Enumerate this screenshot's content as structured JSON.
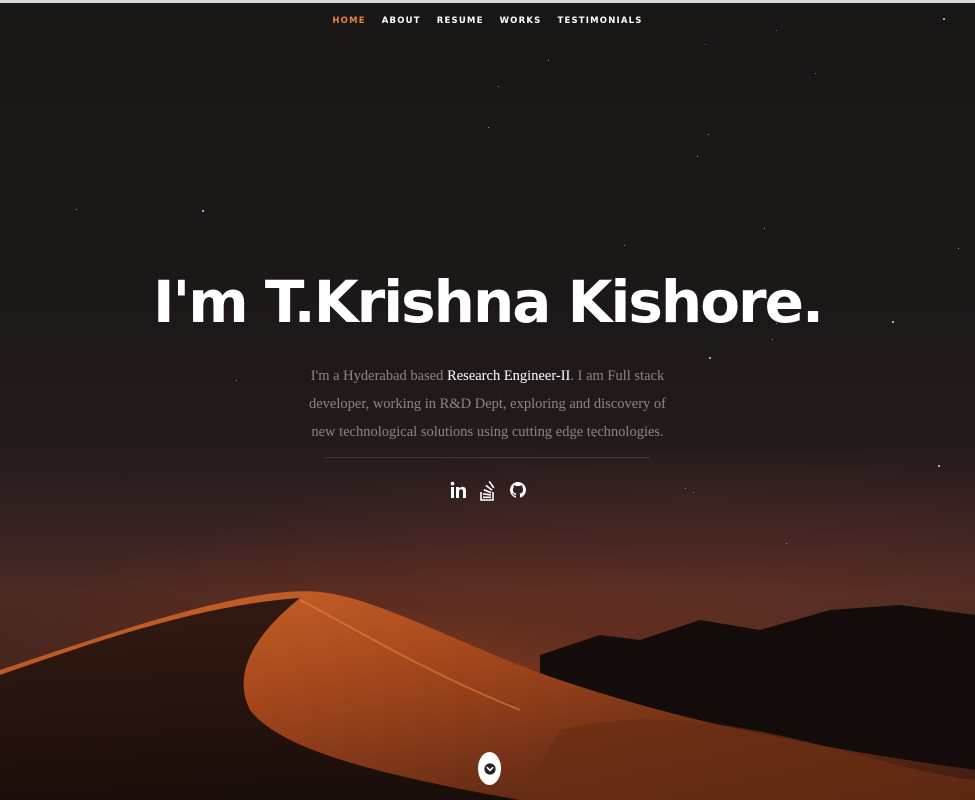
{
  "nav": {
    "items": [
      {
        "label": "HOME",
        "active": true
      },
      {
        "label": "ABOUT",
        "active": false
      },
      {
        "label": "RESUME",
        "active": false
      },
      {
        "label": "WORKS",
        "active": false
      },
      {
        "label": "TESTIMONIALS",
        "active": false
      }
    ]
  },
  "hero": {
    "headline": "I'm T.Krishna Kishore.",
    "intro_prefix": "I'm a Hyderabad based ",
    "intro_highlight": "Research Engineer-II",
    "intro_suffix": ". I am Full stack developer, working in R&D Dept, exploring and discovery of new technological solutions using cutting edge technologies."
  },
  "social": {
    "icons": [
      "linkedin-icon",
      "stackoverflow-icon",
      "github-icon"
    ]
  },
  "colors": {
    "accent": "#e8843a",
    "text": "#ffffff",
    "muted": "#8d8582"
  },
  "scroll": {
    "icon": "chevron-down-icon"
  }
}
